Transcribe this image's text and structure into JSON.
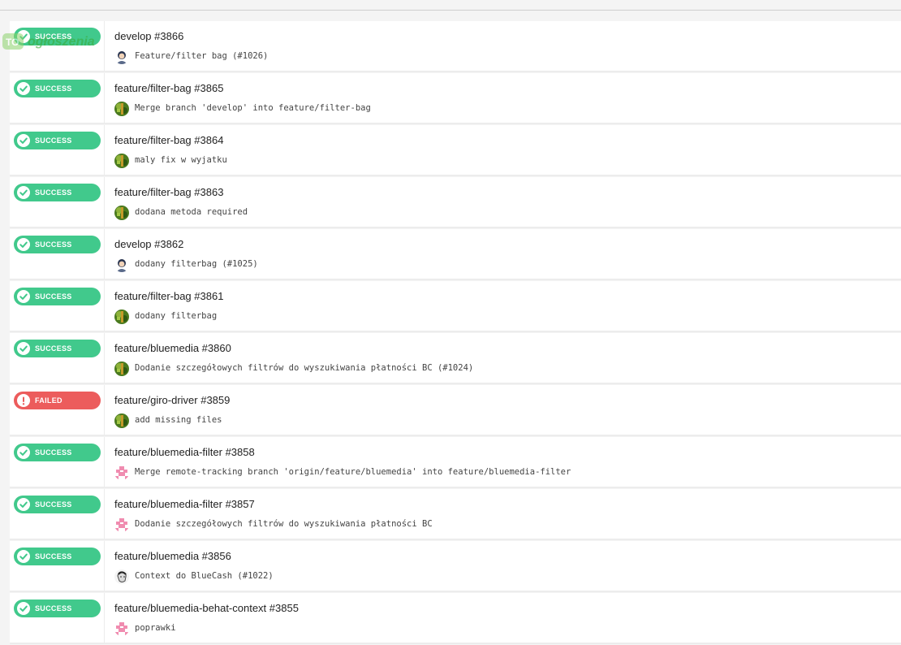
{
  "status_labels": {
    "success": "SUCCESS",
    "failed": "FAILED"
  },
  "colors": {
    "success": "#41c98c",
    "failed": "#ec5c5c"
  },
  "watermark": {
    "text_main": "ogłoszenia",
    "text_accent": ""
  },
  "builds": [
    {
      "status": "success",
      "status_label": "SUCCESS",
      "title": "develop #3866",
      "avatar": "person-avatar-icon",
      "message": "Feature/filter bag (#1026)"
    },
    {
      "status": "success",
      "status_label": "SUCCESS",
      "title": "feature/filter-bag #3865",
      "avatar": "green-avatar-icon",
      "message": "Merge branch 'develop' into feature/filter-bag"
    },
    {
      "status": "success",
      "status_label": "SUCCESS",
      "title": "feature/filter-bag #3864",
      "avatar": "green-avatar-icon",
      "message": "maly fix w wyjatku"
    },
    {
      "status": "success",
      "status_label": "SUCCESS",
      "title": "feature/filter-bag #3863",
      "avatar": "green-avatar-icon",
      "message": "dodana metoda required"
    },
    {
      "status": "success",
      "status_label": "SUCCESS",
      "title": "develop #3862",
      "avatar": "person-avatar-icon",
      "message": "dodany filterbag (#1025)"
    },
    {
      "status": "success",
      "status_label": "SUCCESS",
      "title": "feature/filter-bag #3861",
      "avatar": "green-avatar-icon",
      "message": "dodany filterbag"
    },
    {
      "status": "success",
      "status_label": "SUCCESS",
      "title": "feature/bluemedia #3860",
      "avatar": "green-avatar-icon",
      "message": "Dodanie szczegółowych filtrów do wyszukiwania płatności BC (#1024)"
    },
    {
      "status": "failed",
      "status_label": "FAILED",
      "title": "feature/giro-driver #3859",
      "avatar": "green-avatar-icon",
      "message": "add missing files"
    },
    {
      "status": "success",
      "status_label": "SUCCESS",
      "title": "feature/bluemedia-filter #3858",
      "avatar": "pink-identicon-icon",
      "message": "Merge remote-tracking branch 'origin/feature/bluemedia' into feature/bluemedia-filter"
    },
    {
      "status": "success",
      "status_label": "SUCCESS",
      "title": "feature/bluemedia-filter #3857",
      "avatar": "pink-identicon-icon",
      "message": "Dodanie szczegółowych filtrów do wyszukiwania płatności BC"
    },
    {
      "status": "success",
      "status_label": "SUCCESS",
      "title": "feature/bluemedia #3856",
      "avatar": "sketch-avatar-icon",
      "message": "Context do BlueCash (#1022)"
    },
    {
      "status": "success",
      "status_label": "SUCCESS",
      "title": "feature/bluemedia-behat-context #3855",
      "avatar": "pink-identicon-icon",
      "message": "poprawki"
    }
  ]
}
